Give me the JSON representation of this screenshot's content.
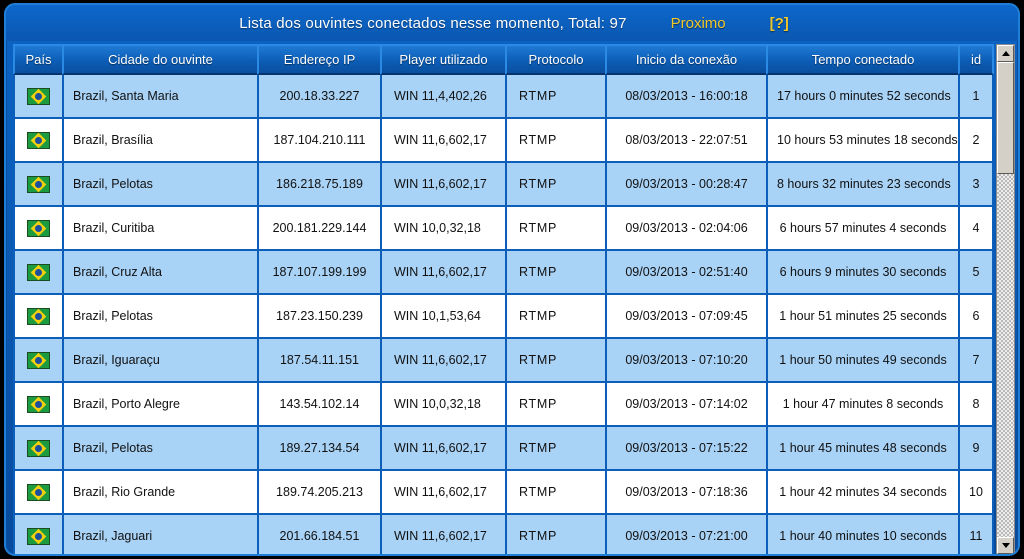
{
  "header": {
    "title": "Lista dos ouvintes conectados nesse momento, Total: 97",
    "next_label": "Proximo",
    "help_label": "[?]",
    "title_color": "#ffffff",
    "link_color": "#f2c829"
  },
  "table": {
    "columns": [
      "País",
      "Cidade do ouvinte",
      "Endereço IP",
      "Player utilizado",
      "Protocolo",
      "Inicio da conexão",
      "Tempo conectado",
      "id"
    ],
    "rows": [
      {
        "flag": "flag-brazil-icon",
        "city": "Brazil, Santa Maria",
        "ip": "200.18.33.227",
        "player": "WIN 11,4,402,26",
        "protocol": "RTMP",
        "start": "08/03/2013 - 16:00:18",
        "connected": "17 hours 0 minutes 52 seconds",
        "id": "1"
      },
      {
        "flag": "flag-brazil-icon",
        "city": "Brazil, Brasília",
        "ip": "187.104.210.111",
        "player": "WIN 11,6,602,17",
        "protocol": "RTMP",
        "start": "08/03/2013 - 22:07:51",
        "connected": "10 hours 53 minutes 18 seconds",
        "id": "2"
      },
      {
        "flag": "flag-brazil-icon",
        "city": "Brazil, Pelotas",
        "ip": "186.218.75.189",
        "player": "WIN 11,6,602,17",
        "protocol": "RTMP",
        "start": "09/03/2013 - 00:28:47",
        "connected": "8 hours 32 minutes 23 seconds",
        "id": "3"
      },
      {
        "flag": "flag-brazil-icon",
        "city": "Brazil, Curitiba",
        "ip": "200.181.229.144",
        "player": "WIN 10,0,32,18",
        "protocol": "RTMP",
        "start": "09/03/2013 - 02:04:06",
        "connected": "6 hours 57 minutes 4 seconds",
        "id": "4"
      },
      {
        "flag": "flag-brazil-icon",
        "city": "Brazil, Cruz Alta",
        "ip": "187.107.199.199",
        "player": "WIN 11,6,602,17",
        "protocol": "RTMP",
        "start": "09/03/2013 - 02:51:40",
        "connected": "6 hours 9 minutes 30 seconds",
        "id": "5"
      },
      {
        "flag": "flag-brazil-icon",
        "city": "Brazil, Pelotas",
        "ip": "187.23.150.239",
        "player": "WIN 10,1,53,64",
        "protocol": "RTMP",
        "start": "09/03/2013 - 07:09:45",
        "connected": "1 hour 51 minutes 25 seconds",
        "id": "6"
      },
      {
        "flag": "flag-brazil-icon",
        "city": "Brazil, Iguaraçu",
        "ip": "187.54.11.151",
        "player": "WIN 11,6,602,17",
        "protocol": "RTMP",
        "start": "09/03/2013 - 07:10:20",
        "connected": "1 hour 50 minutes 49 seconds",
        "id": "7"
      },
      {
        "flag": "flag-brazil-icon",
        "city": "Brazil, Porto Alegre",
        "ip": "143.54.102.14",
        "player": "WIN 10,0,32,18",
        "protocol": "RTMP",
        "start": "09/03/2013 - 07:14:02",
        "connected": "1 hour 47 minutes 8 seconds",
        "id": "8"
      },
      {
        "flag": "flag-brazil-icon",
        "city": "Brazil, Pelotas",
        "ip": "189.27.134.54",
        "player": "WIN 11,6,602,17",
        "protocol": "RTMP",
        "start": "09/03/2013 - 07:15:22",
        "connected": "1 hour 45 minutes 48 seconds",
        "id": "9"
      },
      {
        "flag": "flag-brazil-icon",
        "city": "Brazil, Rio Grande",
        "ip": "189.74.205.213",
        "player": "WIN 11,6,602,17",
        "protocol": "RTMP",
        "start": "09/03/2013 - 07:18:36",
        "connected": "1 hour 42 minutes 34 seconds",
        "id": "10"
      },
      {
        "flag": "flag-brazil-icon",
        "city": "Brazil, Jaguari",
        "ip": "201.66.184.51",
        "player": "WIN 11,6,602,17",
        "protocol": "RTMP",
        "start": "09/03/2013 - 07:21:00",
        "connected": "1 hour 40 minutes 10 seconds",
        "id": "11"
      }
    ]
  },
  "scrollbar": {
    "up_icon": "arrow-up-icon",
    "down_icon": "arrow-down-icon"
  },
  "theme": {
    "panel_blue": "#0a5ab4",
    "header_blue": "#0c5db6",
    "row_alt": "#a8d2f6",
    "row_plain": "#ffffff",
    "grid_line": "#0b5fba"
  }
}
